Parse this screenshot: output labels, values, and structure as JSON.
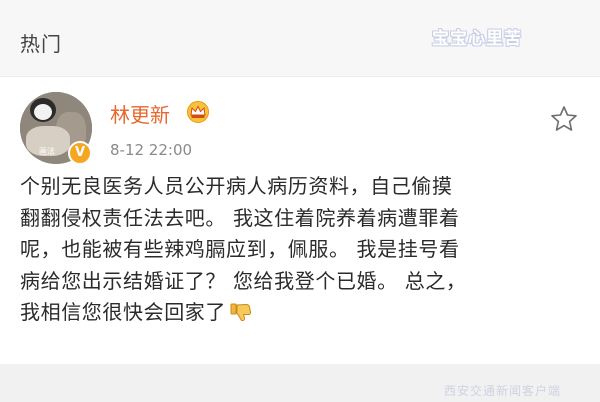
{
  "header": {
    "section_title": "热门",
    "watermark": "宝宝心里苦"
  },
  "post": {
    "author": {
      "name": "林更新",
      "avatar_caption": "画法"
    },
    "timestamp": "8-12 22:00",
    "lines": [
      "个别无良医务人员公开病人病历资料，自己偷摸",
      "翻翻侵权责任法去吧。  我这住着院养着病遭罪着",
      "呢，也能被有些辣鸡膈应到，佩服。  我是挂号看",
      "病给您出示结婚证了？ 您给我登个已婚。  总之，",
      "我相信您很快会回家了"
    ],
    "icons": {
      "crown": "crown-icon",
      "favorite": "star-icon",
      "reaction": "thumbs-down-icon",
      "verified": "verified-icon"
    }
  },
  "footer": {
    "watermark": "西安交通新闻客户端"
  },
  "colors": {
    "username": "#e8672d",
    "badge": "#f5a623",
    "text": "#2b2b2b",
    "timestamp": "#8a8a8a"
  }
}
